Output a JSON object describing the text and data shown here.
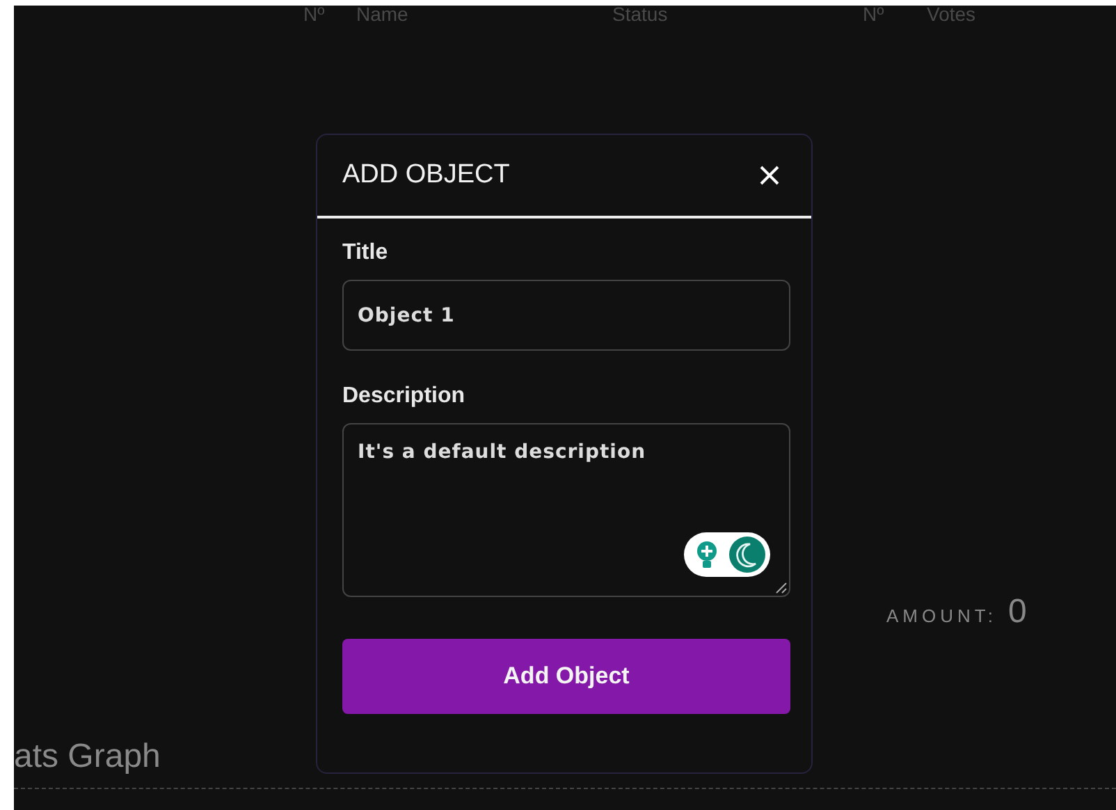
{
  "table": {
    "columns": [
      "Nº",
      "Name",
      "Status",
      "Nº",
      "Votes"
    ]
  },
  "amount": {
    "label": "AMOUNT:",
    "value": "0"
  },
  "graph_section": {
    "title": "ats Graph"
  },
  "modal": {
    "title": "ADD OBJECT",
    "fields": [
      {
        "kind": "input",
        "label": "Title",
        "value": "Object 1"
      },
      {
        "kind": "textarea",
        "label": "Description",
        "value": "It's a default description"
      }
    ],
    "submit": "Add Object"
  }
}
